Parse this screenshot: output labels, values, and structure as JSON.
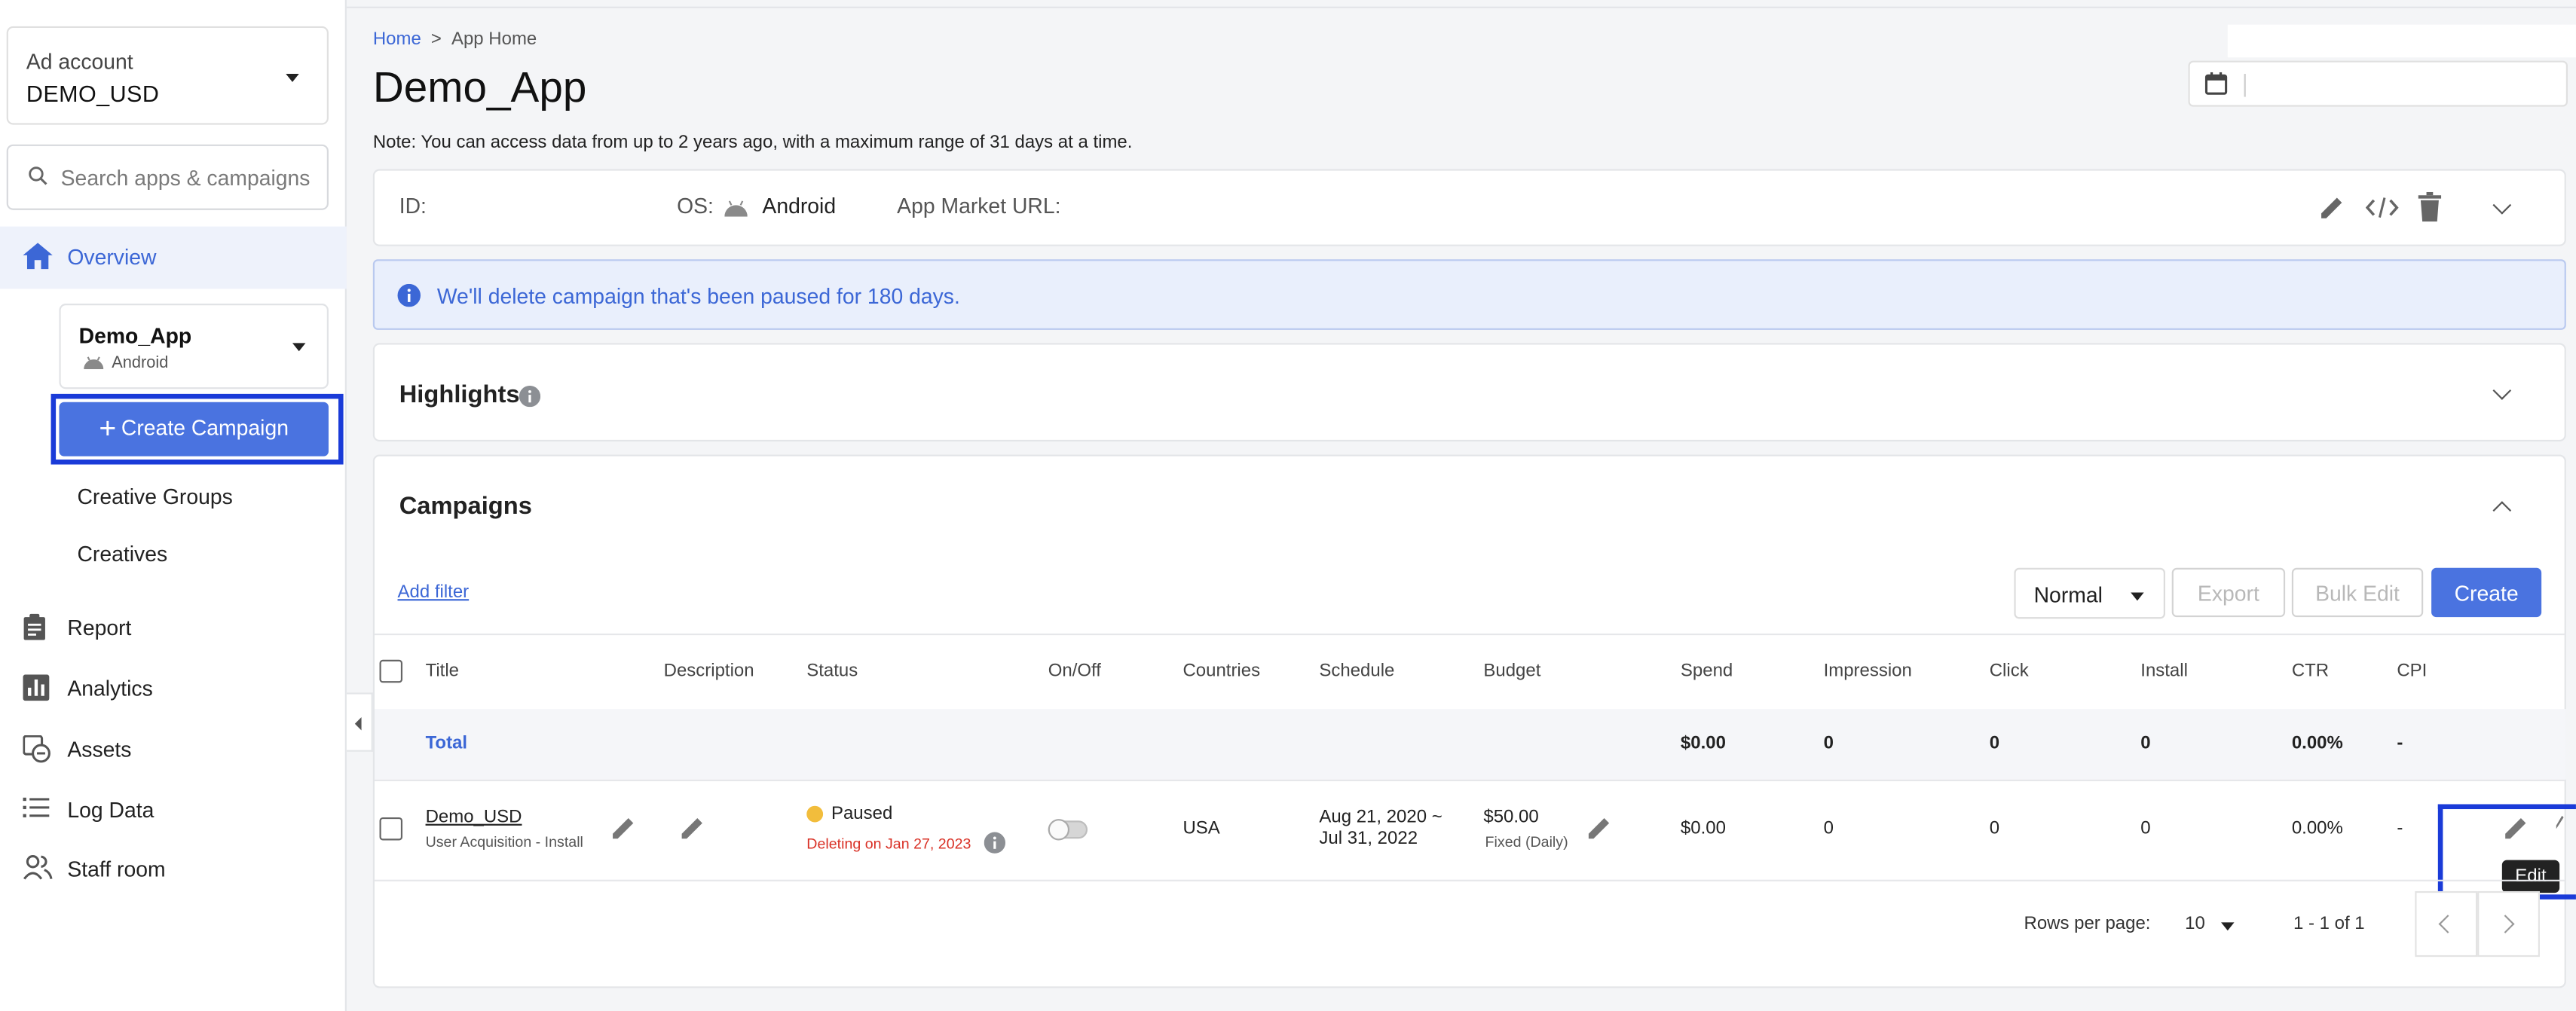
{
  "sidebar": {
    "account_label": "Ad account",
    "account_value": "DEMO_USD",
    "search_placeholder": "Search apps & campaigns",
    "overview": "Overview",
    "app_name": "Demo_App",
    "app_os": "Android",
    "create_campaign": "Create Campaign",
    "creative_groups": "Creative Groups",
    "creatives": "Creatives",
    "nav": [
      "Report",
      "Analytics",
      "Assets",
      "Log Data",
      "Staff room"
    ]
  },
  "header": {
    "breadcrumb_home": "Home",
    "breadcrumb_sep": ">",
    "breadcrumb_current": "App Home",
    "title": "Demo_App",
    "note": "Note: You can access data from up to 2 years ago, with a maximum range of 31 days at a time."
  },
  "app_info": {
    "id_label": "ID:",
    "os_label": "OS:",
    "os_value": "Android",
    "market_label": "App Market URL:"
  },
  "alert": "We'll delete campaign that's been paused for 180 days.",
  "highlights": {
    "title": "Highlights"
  },
  "campaigns": {
    "title": "Campaigns",
    "add_filter": "Add filter",
    "view_select": "Normal",
    "export": "Export",
    "bulk_edit": "Bulk Edit",
    "create": "Create",
    "columns": [
      "Title",
      "Description",
      "Status",
      "On/Off",
      "Countries",
      "Schedule",
      "Budget",
      "Spend",
      "Impression",
      "Click",
      "Install",
      "CTR",
      "CPI"
    ],
    "total": {
      "label": "Total",
      "spend": "$0.00",
      "impression": "0",
      "click": "0",
      "install": "0",
      "ctr": "0.00%",
      "cpi": "-"
    },
    "rows": [
      {
        "title": "Demo_USD",
        "subtitle": "User Acquisition - Install",
        "status": "Paused",
        "status_note": "Deleting on Jan 27, 2023",
        "on": false,
        "countries": "USA",
        "schedule_start": "Aug 21, 2020 ~",
        "schedule_end": "Jul 31, 2022",
        "budget": "$50.00",
        "budget_type": "Fixed (Daily)",
        "spend": "$0.00",
        "impression": "0",
        "click": "0",
        "install": "0",
        "ctr": "0.00%",
        "cpi": "-"
      }
    ],
    "tooltip": "Edit",
    "rows_per_page_label": "Rows per page:",
    "rows_per_page": "10",
    "range": "1 - 1 of 1"
  },
  "colors": {
    "accent": "#4a73e0",
    "link": "#3c67d6",
    "status_paused": "#f2bd3c",
    "deleting": "#d93025",
    "highlight_box": "#1a3bd8"
  }
}
